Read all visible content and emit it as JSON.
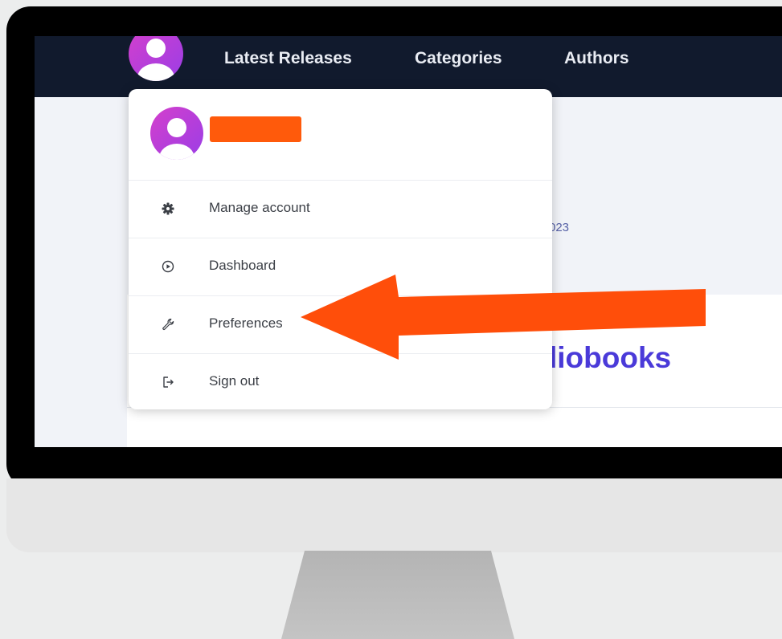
{
  "navbar": {
    "links": [
      "Latest Releases",
      "Categories",
      "Authors"
    ],
    "background_color": "#111a2d"
  },
  "page": {
    "date_fragment": "023",
    "heading_fragment": "liobooks"
  },
  "user_menu": {
    "avatar_color": "#c03fd6",
    "redaction_color": "#ff5a0b",
    "items": [
      {
        "label": "Manage account",
        "icon": "gear-icon"
      },
      {
        "label": "Dashboard",
        "icon": "play-circle-icon"
      },
      {
        "label": "Preferences",
        "icon": "wrench-icon"
      },
      {
        "label": "Sign out",
        "icon": "sign-out-icon"
      }
    ]
  },
  "annotation": {
    "arrow_color": "#ff4e0a",
    "points_to": "Preferences"
  }
}
